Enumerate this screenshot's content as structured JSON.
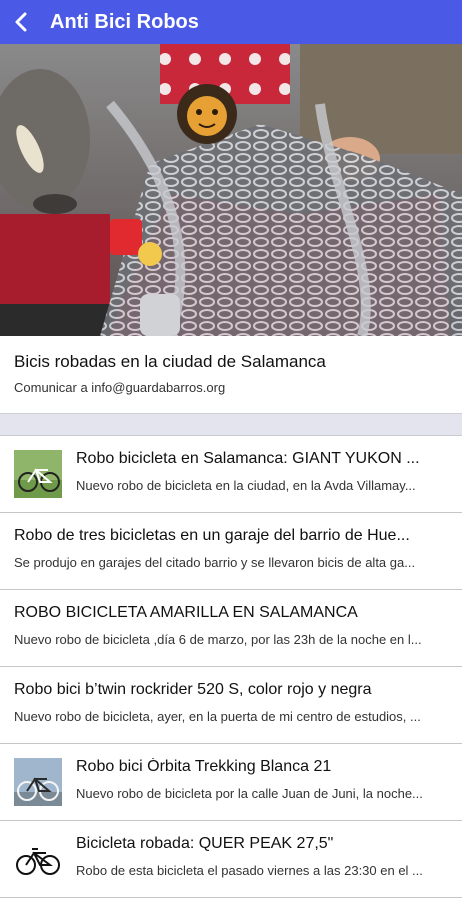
{
  "app": {
    "title": "Anti Bici Robos",
    "accent": "#4a5ae6",
    "back_icon": "back-arrow-icon"
  },
  "hero": {
    "image": "bicycle-wrapped-in-chains-photo"
  },
  "header": {
    "title": "Bicis robadas en la ciudad de Salamanca",
    "subtitle": "Comunicar a info@guardabarros.org"
  },
  "items": [
    {
      "title": "Robo bicicleta en Salamanca: GIANT YUKON ...",
      "desc": "Nuevo robo de bicicleta en la ciudad, en la  Avda Villamay...",
      "thumb": "green-mountain-bike-photo"
    },
    {
      "title": "Robo de tres bicicletas en un garaje del barrio de Hue...",
      "desc": "Se produjo en garajes del citado barrio y se llevaron bicis de alta ga...",
      "thumb": ""
    },
    {
      "title": "ROBO BICICLETA AMARILLA EN SALAMANCA",
      "desc": "Nuevo robo de bicicleta ,día 6 de marzo, por las 23h de la noche en l...",
      "thumb": ""
    },
    {
      "title": "Robo bici b’twin rockrider 520 S, color rojo y negra",
      "desc": "Nuevo robo de bicicleta, ayer, en la puerta de mi centro de estudios, ...",
      "thumb": ""
    },
    {
      "title": "Robo bici Órbita Trekking Blanca 21",
      "desc": "Nuevo robo de bicicleta por la calle Juan de Juni, la noche...",
      "thumb": "white-trekking-bike-photo"
    },
    {
      "title": "Bicicleta robada: QUER PEAK 27,5\"",
      "desc": "Robo de esta bicicleta el pasado viernes a las 23:30 en el ...",
      "thumb": "bicycle-icon"
    }
  ]
}
